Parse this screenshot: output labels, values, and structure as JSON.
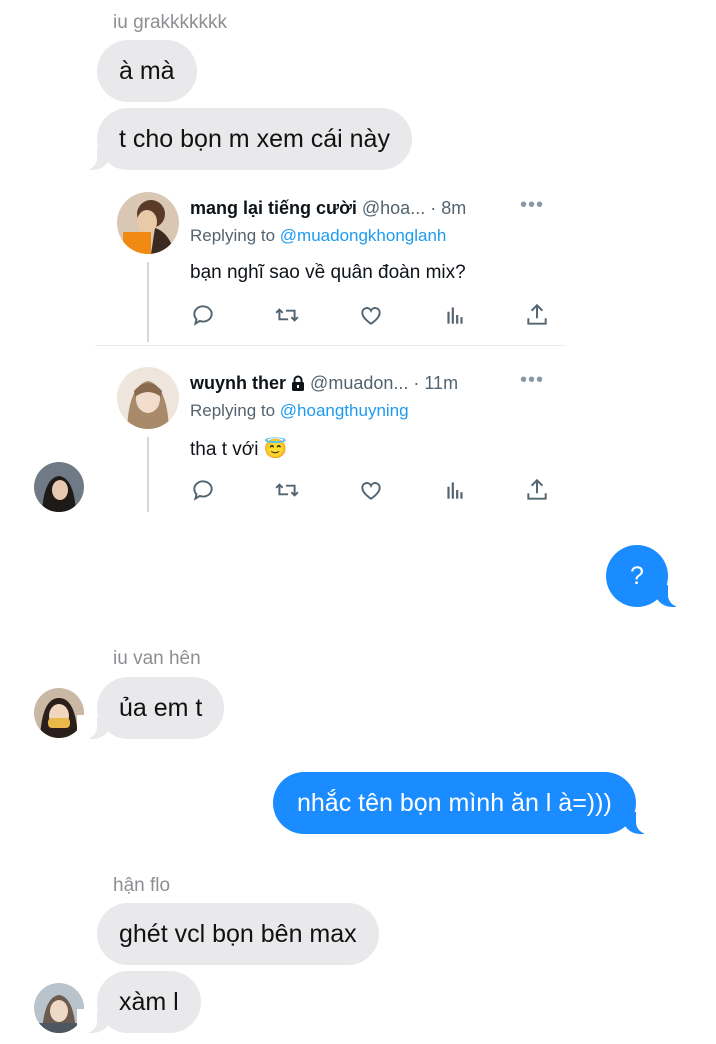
{
  "messages": {
    "sender1": "iu grakkkkkkk",
    "b1": "à mà",
    "b2": "t cho bọn m xem cái này",
    "out1": "?",
    "sender2": "iu van hên",
    "b3": "ủa em t",
    "out2": "nhắc tên bọn mình ăn l à=)))",
    "sender3": "hận flo",
    "b4": "ghét vcl bọn bên max",
    "b5": "xàm l"
  },
  "tweets": [
    {
      "name": "mang lại tiếng cười",
      "handle": "@hoa...",
      "time": "· 8m",
      "replying_prefix": "Replying to ",
      "replying_to": "@muadongkhonglanh",
      "text": "bạn nghĩ sao về quân đoàn mix?"
    },
    {
      "name": "wuynh ther",
      "handle": "@muadon...",
      "time": "· 11m",
      "replying_prefix": "Replying to ",
      "replying_to": "@hoangthuyning",
      "text": "tha t với",
      "emoji": "😇"
    }
  ],
  "colors": {
    "incoming_bubble": "#e9e9eb",
    "outgoing_bubble": "#1a8cff",
    "link": "#1d9bf0"
  },
  "icons": [
    "reply-icon",
    "retweet-icon",
    "like-icon",
    "views-icon",
    "share-icon",
    "lock-icon",
    "more-icon"
  ]
}
